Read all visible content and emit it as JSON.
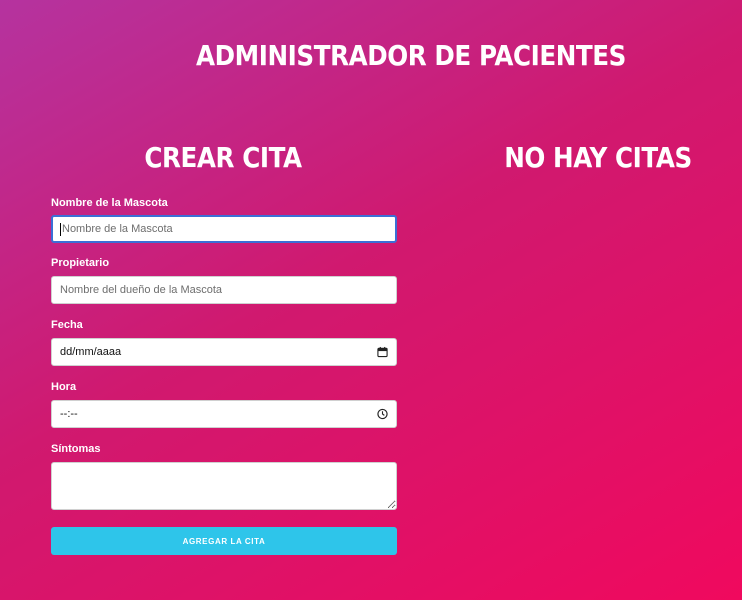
{
  "header": {
    "title": "ADMINISTRADOR DE PACIENTES"
  },
  "form_section": {
    "title": "CREAR CITA",
    "fields": {
      "mascota": {
        "label": "Nombre de la Mascota",
        "placeholder": "Nombre de la Mascota"
      },
      "propietario": {
        "label": "Propietario",
        "placeholder": "Nombre del dueño de la Mascota"
      },
      "fecha": {
        "label": "Fecha",
        "value": "dd/mm/aaaa",
        "icon": "calendar-icon"
      },
      "hora": {
        "label": "Hora",
        "value": "--:--",
        "icon": "clock-icon"
      },
      "sintomas": {
        "label": "Síntomas",
        "value": ""
      }
    },
    "submit_label": "AGREGAR LA CITA"
  },
  "appointments_section": {
    "title": "NO HAY CITAS"
  },
  "colors": {
    "accent": "#2ec5ea",
    "focus": "#3b6fd6",
    "bg_start": "#b5339f",
    "bg_end": "#f0095e"
  }
}
